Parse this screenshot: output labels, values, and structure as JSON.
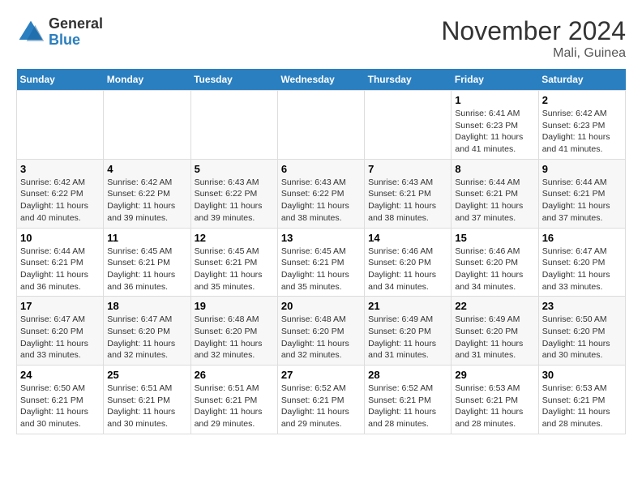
{
  "logo": {
    "general": "General",
    "blue": "Blue"
  },
  "title": "November 2024",
  "subtitle": "Mali, Guinea",
  "days_header": [
    "Sunday",
    "Monday",
    "Tuesday",
    "Wednesday",
    "Thursday",
    "Friday",
    "Saturday"
  ],
  "weeks": [
    [
      {
        "day": "",
        "info": ""
      },
      {
        "day": "",
        "info": ""
      },
      {
        "day": "",
        "info": ""
      },
      {
        "day": "",
        "info": ""
      },
      {
        "day": "",
        "info": ""
      },
      {
        "day": "1",
        "info": "Sunrise: 6:41 AM\nSunset: 6:23 PM\nDaylight: 11 hours and 41 minutes."
      },
      {
        "day": "2",
        "info": "Sunrise: 6:42 AM\nSunset: 6:23 PM\nDaylight: 11 hours and 41 minutes."
      }
    ],
    [
      {
        "day": "3",
        "info": "Sunrise: 6:42 AM\nSunset: 6:22 PM\nDaylight: 11 hours and 40 minutes."
      },
      {
        "day": "4",
        "info": "Sunrise: 6:42 AM\nSunset: 6:22 PM\nDaylight: 11 hours and 39 minutes."
      },
      {
        "day": "5",
        "info": "Sunrise: 6:43 AM\nSunset: 6:22 PM\nDaylight: 11 hours and 39 minutes."
      },
      {
        "day": "6",
        "info": "Sunrise: 6:43 AM\nSunset: 6:22 PM\nDaylight: 11 hours and 38 minutes."
      },
      {
        "day": "7",
        "info": "Sunrise: 6:43 AM\nSunset: 6:21 PM\nDaylight: 11 hours and 38 minutes."
      },
      {
        "day": "8",
        "info": "Sunrise: 6:44 AM\nSunset: 6:21 PM\nDaylight: 11 hours and 37 minutes."
      },
      {
        "day": "9",
        "info": "Sunrise: 6:44 AM\nSunset: 6:21 PM\nDaylight: 11 hours and 37 minutes."
      }
    ],
    [
      {
        "day": "10",
        "info": "Sunrise: 6:44 AM\nSunset: 6:21 PM\nDaylight: 11 hours and 36 minutes."
      },
      {
        "day": "11",
        "info": "Sunrise: 6:45 AM\nSunset: 6:21 PM\nDaylight: 11 hours and 36 minutes."
      },
      {
        "day": "12",
        "info": "Sunrise: 6:45 AM\nSunset: 6:21 PM\nDaylight: 11 hours and 35 minutes."
      },
      {
        "day": "13",
        "info": "Sunrise: 6:45 AM\nSunset: 6:21 PM\nDaylight: 11 hours and 35 minutes."
      },
      {
        "day": "14",
        "info": "Sunrise: 6:46 AM\nSunset: 6:20 PM\nDaylight: 11 hours and 34 minutes."
      },
      {
        "day": "15",
        "info": "Sunrise: 6:46 AM\nSunset: 6:20 PM\nDaylight: 11 hours and 34 minutes."
      },
      {
        "day": "16",
        "info": "Sunrise: 6:47 AM\nSunset: 6:20 PM\nDaylight: 11 hours and 33 minutes."
      }
    ],
    [
      {
        "day": "17",
        "info": "Sunrise: 6:47 AM\nSunset: 6:20 PM\nDaylight: 11 hours and 33 minutes."
      },
      {
        "day": "18",
        "info": "Sunrise: 6:47 AM\nSunset: 6:20 PM\nDaylight: 11 hours and 32 minutes."
      },
      {
        "day": "19",
        "info": "Sunrise: 6:48 AM\nSunset: 6:20 PM\nDaylight: 11 hours and 32 minutes."
      },
      {
        "day": "20",
        "info": "Sunrise: 6:48 AM\nSunset: 6:20 PM\nDaylight: 11 hours and 32 minutes."
      },
      {
        "day": "21",
        "info": "Sunrise: 6:49 AM\nSunset: 6:20 PM\nDaylight: 11 hours and 31 minutes."
      },
      {
        "day": "22",
        "info": "Sunrise: 6:49 AM\nSunset: 6:20 PM\nDaylight: 11 hours and 31 minutes."
      },
      {
        "day": "23",
        "info": "Sunrise: 6:50 AM\nSunset: 6:20 PM\nDaylight: 11 hours and 30 minutes."
      }
    ],
    [
      {
        "day": "24",
        "info": "Sunrise: 6:50 AM\nSunset: 6:21 PM\nDaylight: 11 hours and 30 minutes."
      },
      {
        "day": "25",
        "info": "Sunrise: 6:51 AM\nSunset: 6:21 PM\nDaylight: 11 hours and 30 minutes."
      },
      {
        "day": "26",
        "info": "Sunrise: 6:51 AM\nSunset: 6:21 PM\nDaylight: 11 hours and 29 minutes."
      },
      {
        "day": "27",
        "info": "Sunrise: 6:52 AM\nSunset: 6:21 PM\nDaylight: 11 hours and 29 minutes."
      },
      {
        "day": "28",
        "info": "Sunrise: 6:52 AM\nSunset: 6:21 PM\nDaylight: 11 hours and 28 minutes."
      },
      {
        "day": "29",
        "info": "Sunrise: 6:53 AM\nSunset: 6:21 PM\nDaylight: 11 hours and 28 minutes."
      },
      {
        "day": "30",
        "info": "Sunrise: 6:53 AM\nSunset: 6:21 PM\nDaylight: 11 hours and 28 minutes."
      }
    ]
  ]
}
